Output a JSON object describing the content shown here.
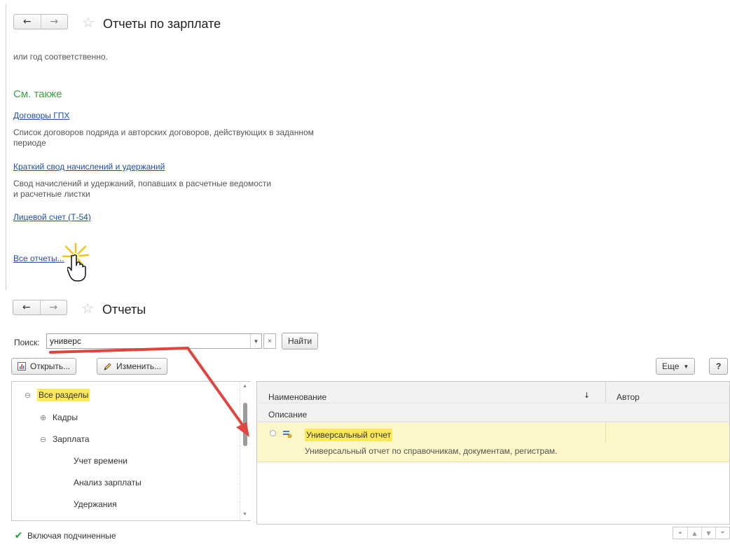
{
  "top_panel": {
    "nav_back": "←",
    "nav_forward": "→",
    "star": "☆",
    "title": "Отчеты по зарплате",
    "intro_text": "или год соответственно.",
    "see_also": "См. также",
    "links": [
      {
        "label": "Договоры ГПХ",
        "desc_line1": "Список договоров подряда и авторских договоров, действующих в заданном",
        "desc_line2": "периоде"
      },
      {
        "label": "Краткий свод начислений и удержаний",
        "desc_line1": "Свод начислений и удержаний, попавших в расчетные ведомости",
        "desc_line2": "и расчетные листки"
      },
      {
        "label": "Лицевой счет (Т-54)"
      }
    ],
    "all_reports": "Все отчеты..."
  },
  "bottom_panel": {
    "nav_back": "←",
    "nav_forward": "→",
    "star": "☆",
    "title": "Отчеты",
    "search": {
      "label": "Поиск:",
      "value": "универс",
      "clear": "×",
      "find_button": "Найти"
    },
    "toolbar": {
      "open": "Открыть...",
      "edit": "Изменить...",
      "more": "Еще",
      "help": "?"
    },
    "tree": {
      "items": [
        {
          "label": "Все разделы",
          "toggle": "⊖",
          "selected": true
        },
        {
          "label": "Кадры",
          "toggle": "⊕"
        },
        {
          "label": "Зарплата",
          "toggle": "⊖"
        },
        {
          "label": "Учет времени"
        },
        {
          "label": "Анализ зарплаты"
        },
        {
          "label": "Удержания"
        }
      ]
    },
    "grid": {
      "headers": {
        "name": "Наименование",
        "sort": "↓",
        "author": "Автор",
        "description": "Описание"
      },
      "rows": [
        {
          "name": "Универсальный отчет",
          "description": "Универсальный отчет по справочникам, документам, регистрам."
        }
      ]
    },
    "include_subordinate": "Включая подчиненные",
    "colors": {
      "highlight": "#fbe95a",
      "row_bg": "#fcf6c8",
      "link": "#1d4fa5",
      "section": "#3fa046",
      "arrow": "#e0443e"
    }
  }
}
